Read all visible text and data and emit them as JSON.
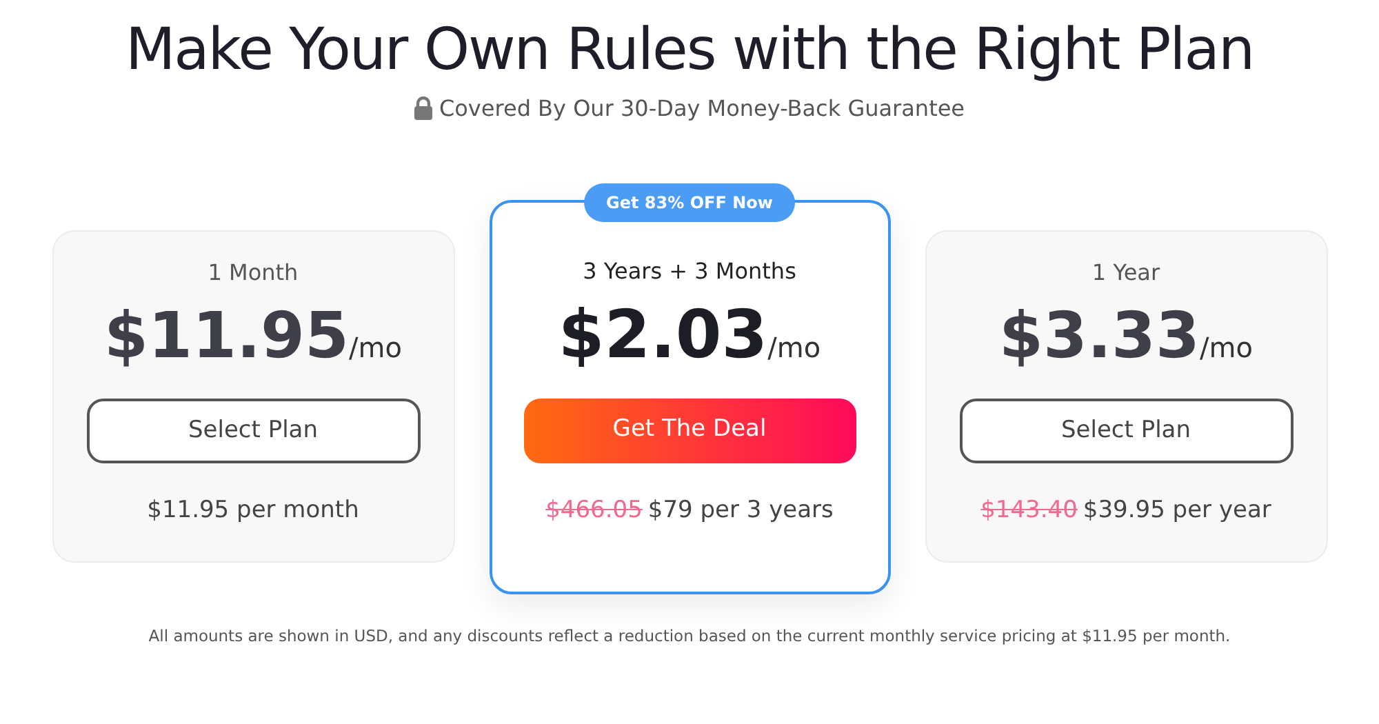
{
  "title": "Make Your Own Rules with the Right Plan",
  "subtitle": "Covered By Our 30-Day Money-Back Guarantee",
  "plans": [
    {
      "kind": "standard",
      "name": "1 Month",
      "price": "$11.95",
      "unit": "/mo",
      "button": "Select Plan",
      "billing": "$11.95 per month"
    },
    {
      "kind": "featured",
      "badge": "Get 83% OFF Now",
      "name": "3 Years + 3 Months",
      "price": "$2.03",
      "unit": "/mo",
      "button": "Get The Deal",
      "original_price": "$466.05",
      "billing": "$79 per 3 years"
    },
    {
      "kind": "standard",
      "name": "1 Year",
      "price": "$3.33",
      "unit": "/mo",
      "button": "Select Plan",
      "original_price": "$143.40",
      "billing": "$39.95 per year"
    }
  ],
  "footnote": "All amounts are shown in USD, and any discounts reflect a reduction based on the current monthly service pricing at $11.95 per month."
}
